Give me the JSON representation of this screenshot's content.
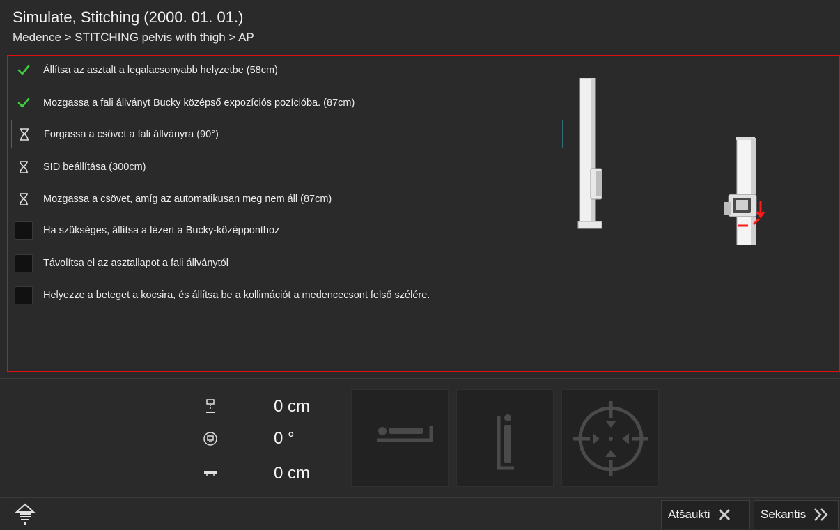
{
  "header": {
    "title": "Simulate, Stitching (2000. 01. 01.)",
    "breadcrumb": "Medence > STITCHING pelvis with thigh > AP"
  },
  "steps": [
    {
      "label": "Állítsa az asztalt a legalacsonyabb helyzetbe (58cm)",
      "status": "done",
      "icon": "check-icon"
    },
    {
      "label": "Mozgassa a fali állványt Bucky középső expozíciós pozícióba. (87cm)",
      "status": "done",
      "icon": "check-icon"
    },
    {
      "label": "Forgassa a csövet a fali állványra (90°)",
      "status": "pending",
      "icon": "hourglass-icon",
      "active": true
    },
    {
      "label": "SID beállítása (300cm)",
      "status": "pending",
      "icon": "hourglass-icon"
    },
    {
      "label": "Mozgassa a csövet, amíg az automatikusan meg nem áll (87cm)",
      "status": "pending",
      "icon": "hourglass-icon"
    },
    {
      "label": "Ha szükséges, állítsa a lézert a Bucky-középponthoz",
      "status": "manual",
      "icon": "checkbox"
    },
    {
      "label": "Távolítsa el az asztallapot a fali állványtól",
      "status": "manual",
      "icon": "checkbox"
    },
    {
      "label": "Helyezze a beteget a kocsira, és állítsa be a kollimációt a medencecsont felső szélére.",
      "status": "manual",
      "icon": "checkbox"
    }
  ],
  "readouts": [
    {
      "icon": "tube-height-icon",
      "value": "0 cm"
    },
    {
      "icon": "tube-rotation-icon",
      "value": "0 °"
    },
    {
      "icon": "table-height-icon",
      "value": "0 cm"
    }
  ],
  "tiles": [
    {
      "icon": "patient-lying-icon"
    },
    {
      "icon": "patient-standing-icon"
    },
    {
      "icon": "center-target-icon"
    }
  ],
  "footer": {
    "cancel_label": "Atšaukti",
    "next_label": "Sekantis"
  },
  "colors": {
    "check": "#3ecf3e",
    "alert_border": "#e01010",
    "active_border": "#2f6f78",
    "arrow_red": "#ff1a1a"
  }
}
